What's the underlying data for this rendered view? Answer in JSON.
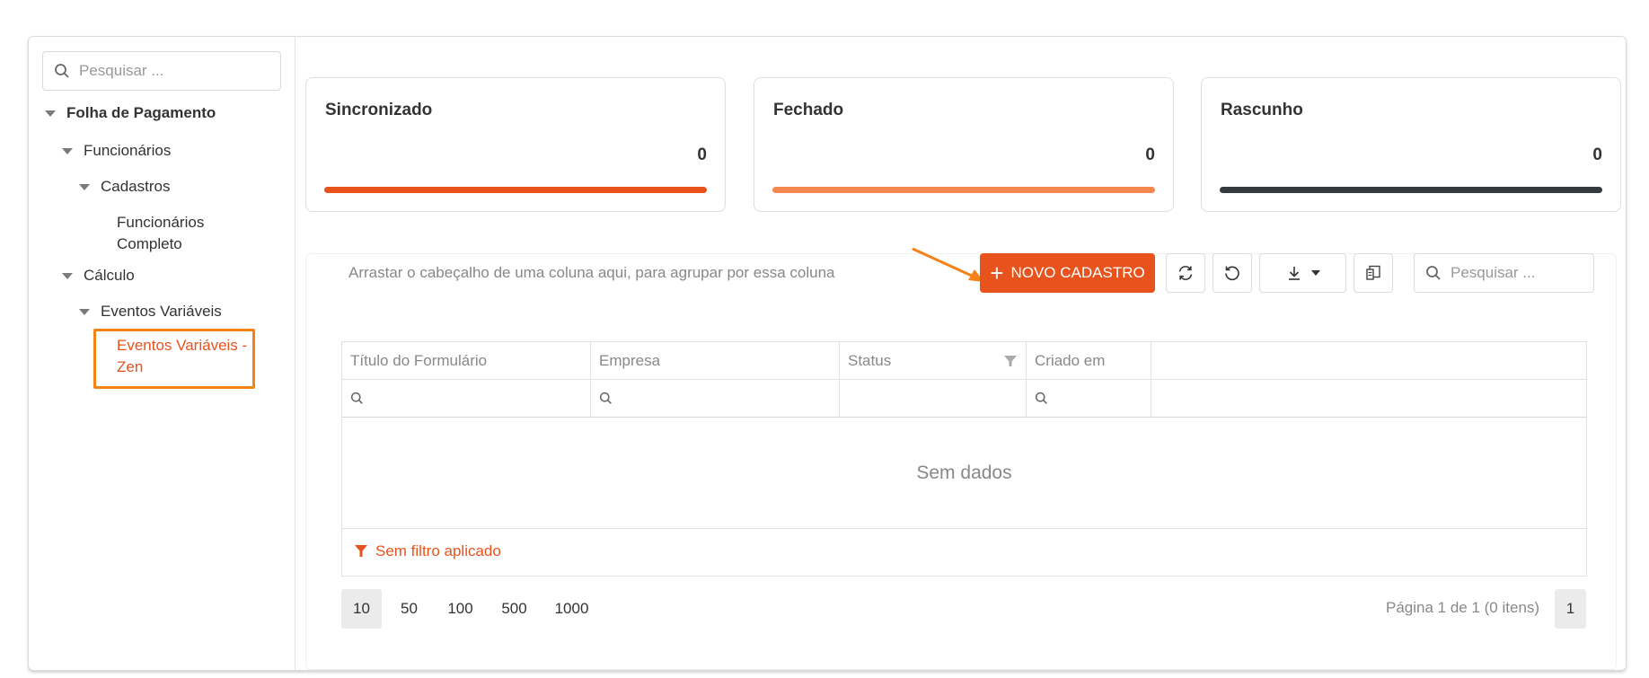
{
  "sidebar": {
    "search_placeholder": "Pesquisar ...",
    "tree": {
      "root": "Folha de Pagamento",
      "funcionarios": "Funcionários",
      "cadastros": "Cadastros",
      "funcionarios_completo_1": "Funcionários",
      "funcionarios_completo_2": "Completo",
      "calculo": "Cálculo",
      "eventos_variaveis": "Eventos Variáveis",
      "eventos_zen_1": "Eventos Variáveis -",
      "eventos_zen_2": "Zen"
    }
  },
  "cards": [
    {
      "title": "Sincronizado",
      "value": "0",
      "color": "#e8531d"
    },
    {
      "title": "Fechado",
      "value": "0",
      "color": "#f4874f"
    },
    {
      "title": "Rascunho",
      "value": "0",
      "color": "#343a40"
    }
  ],
  "grid": {
    "group_hint": "Arrastar o cabeçalho de uma coluna aqui, para agrupar por essa coluna",
    "new_button": "NOVO CADASTRO",
    "search_placeholder": "Pesquisar ...",
    "columns": [
      "Título do Formulário",
      "Empresa",
      "Status",
      "Criado em"
    ],
    "no_data": "Sem dados",
    "no_filter": "Sem filtro aplicado",
    "page_sizes": [
      "10",
      "50",
      "100",
      "500",
      "1000"
    ],
    "selected_page_size": "10",
    "page_info": "Página 1 de 1 (0 itens)",
    "current_page": "1"
  },
  "colors": {
    "accent": "#e8531d",
    "highlight": "#f58216"
  },
  "icons": [
    "search-icon",
    "caret-down-icon",
    "plus-icon",
    "refresh-icon",
    "undo-icon",
    "download-icon",
    "column-chooser-icon",
    "filter-icon",
    "arrow-annotation"
  ]
}
